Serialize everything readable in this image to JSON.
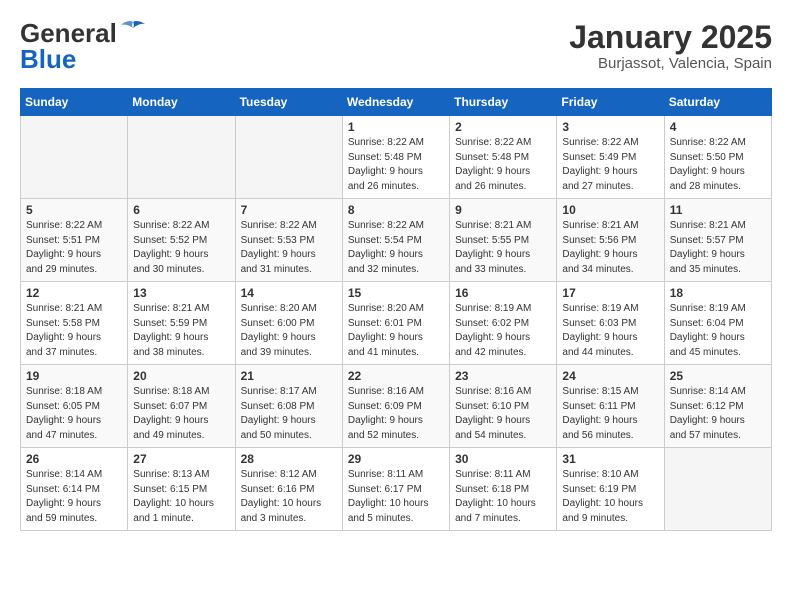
{
  "header": {
    "logo_line1": "General",
    "logo_line2": "Blue",
    "month": "January 2025",
    "location": "Burjassot, Valencia, Spain"
  },
  "weekdays": [
    "Sunday",
    "Monday",
    "Tuesday",
    "Wednesday",
    "Thursday",
    "Friday",
    "Saturday"
  ],
  "weeks": [
    [
      {
        "day": "",
        "info": ""
      },
      {
        "day": "",
        "info": ""
      },
      {
        "day": "",
        "info": ""
      },
      {
        "day": "1",
        "info": "Sunrise: 8:22 AM\nSunset: 5:48 PM\nDaylight: 9 hours\nand 26 minutes."
      },
      {
        "day": "2",
        "info": "Sunrise: 8:22 AM\nSunset: 5:48 PM\nDaylight: 9 hours\nand 26 minutes."
      },
      {
        "day": "3",
        "info": "Sunrise: 8:22 AM\nSunset: 5:49 PM\nDaylight: 9 hours\nand 27 minutes."
      },
      {
        "day": "4",
        "info": "Sunrise: 8:22 AM\nSunset: 5:50 PM\nDaylight: 9 hours\nand 28 minutes."
      }
    ],
    [
      {
        "day": "5",
        "info": "Sunrise: 8:22 AM\nSunset: 5:51 PM\nDaylight: 9 hours\nand 29 minutes."
      },
      {
        "day": "6",
        "info": "Sunrise: 8:22 AM\nSunset: 5:52 PM\nDaylight: 9 hours\nand 30 minutes."
      },
      {
        "day": "7",
        "info": "Sunrise: 8:22 AM\nSunset: 5:53 PM\nDaylight: 9 hours\nand 31 minutes."
      },
      {
        "day": "8",
        "info": "Sunrise: 8:22 AM\nSunset: 5:54 PM\nDaylight: 9 hours\nand 32 minutes."
      },
      {
        "day": "9",
        "info": "Sunrise: 8:21 AM\nSunset: 5:55 PM\nDaylight: 9 hours\nand 33 minutes."
      },
      {
        "day": "10",
        "info": "Sunrise: 8:21 AM\nSunset: 5:56 PM\nDaylight: 9 hours\nand 34 minutes."
      },
      {
        "day": "11",
        "info": "Sunrise: 8:21 AM\nSunset: 5:57 PM\nDaylight: 9 hours\nand 35 minutes."
      }
    ],
    [
      {
        "day": "12",
        "info": "Sunrise: 8:21 AM\nSunset: 5:58 PM\nDaylight: 9 hours\nand 37 minutes."
      },
      {
        "day": "13",
        "info": "Sunrise: 8:21 AM\nSunset: 5:59 PM\nDaylight: 9 hours\nand 38 minutes."
      },
      {
        "day": "14",
        "info": "Sunrise: 8:20 AM\nSunset: 6:00 PM\nDaylight: 9 hours\nand 39 minutes."
      },
      {
        "day": "15",
        "info": "Sunrise: 8:20 AM\nSunset: 6:01 PM\nDaylight: 9 hours\nand 41 minutes."
      },
      {
        "day": "16",
        "info": "Sunrise: 8:19 AM\nSunset: 6:02 PM\nDaylight: 9 hours\nand 42 minutes."
      },
      {
        "day": "17",
        "info": "Sunrise: 8:19 AM\nSunset: 6:03 PM\nDaylight: 9 hours\nand 44 minutes."
      },
      {
        "day": "18",
        "info": "Sunrise: 8:19 AM\nSunset: 6:04 PM\nDaylight: 9 hours\nand 45 minutes."
      }
    ],
    [
      {
        "day": "19",
        "info": "Sunrise: 8:18 AM\nSunset: 6:05 PM\nDaylight: 9 hours\nand 47 minutes."
      },
      {
        "day": "20",
        "info": "Sunrise: 8:18 AM\nSunset: 6:07 PM\nDaylight: 9 hours\nand 49 minutes."
      },
      {
        "day": "21",
        "info": "Sunrise: 8:17 AM\nSunset: 6:08 PM\nDaylight: 9 hours\nand 50 minutes."
      },
      {
        "day": "22",
        "info": "Sunrise: 8:16 AM\nSunset: 6:09 PM\nDaylight: 9 hours\nand 52 minutes."
      },
      {
        "day": "23",
        "info": "Sunrise: 8:16 AM\nSunset: 6:10 PM\nDaylight: 9 hours\nand 54 minutes."
      },
      {
        "day": "24",
        "info": "Sunrise: 8:15 AM\nSunset: 6:11 PM\nDaylight: 9 hours\nand 56 minutes."
      },
      {
        "day": "25",
        "info": "Sunrise: 8:14 AM\nSunset: 6:12 PM\nDaylight: 9 hours\nand 57 minutes."
      }
    ],
    [
      {
        "day": "26",
        "info": "Sunrise: 8:14 AM\nSunset: 6:14 PM\nDaylight: 9 hours\nand 59 minutes."
      },
      {
        "day": "27",
        "info": "Sunrise: 8:13 AM\nSunset: 6:15 PM\nDaylight: 10 hours\nand 1 minute."
      },
      {
        "day": "28",
        "info": "Sunrise: 8:12 AM\nSunset: 6:16 PM\nDaylight: 10 hours\nand 3 minutes."
      },
      {
        "day": "29",
        "info": "Sunrise: 8:11 AM\nSunset: 6:17 PM\nDaylight: 10 hours\nand 5 minutes."
      },
      {
        "day": "30",
        "info": "Sunrise: 8:11 AM\nSunset: 6:18 PM\nDaylight: 10 hours\nand 7 minutes."
      },
      {
        "day": "31",
        "info": "Sunrise: 8:10 AM\nSunset: 6:19 PM\nDaylight: 10 hours\nand 9 minutes."
      },
      {
        "day": "",
        "info": ""
      }
    ]
  ]
}
